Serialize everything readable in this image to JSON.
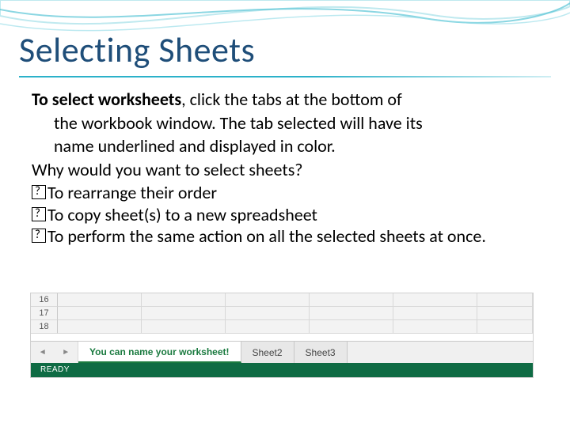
{
  "slide": {
    "title": "Selecting Sheets",
    "lead_bold": "To select worksheets",
    "lead_rest": ", click the tabs at the bottom of",
    "line2": "the workbook window. The tab selected will have its",
    "line3": "name underlined and displayed in color.",
    "question": "Why would you want to select sheets?",
    "bullets": [
      "To rearrange their order",
      "To copy sheet(s) to a new spreadsheet",
      "To perform the same action on all the selected sheets at once."
    ]
  },
  "excel": {
    "rows": [
      "16",
      "17",
      "18"
    ],
    "tabs": {
      "active": "You can name your worksheet!",
      "others": [
        "Sheet2",
        "Sheet3"
      ]
    },
    "nav_left": "◄",
    "nav_right": "►",
    "status": "READY"
  }
}
